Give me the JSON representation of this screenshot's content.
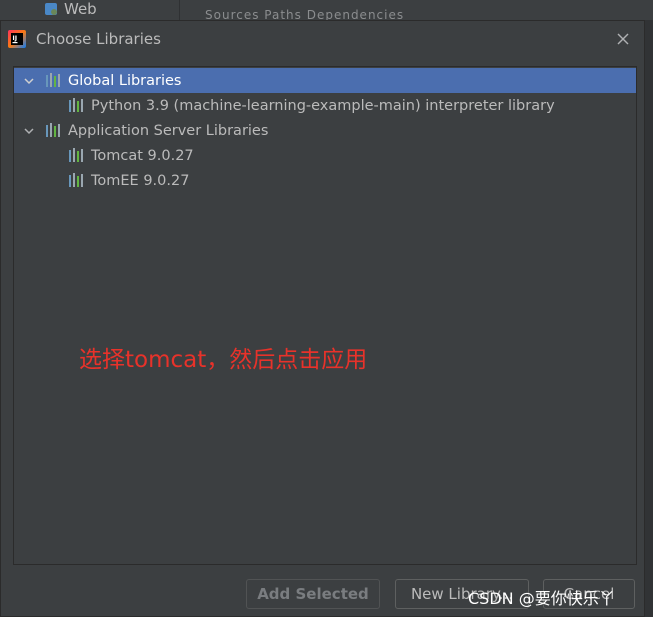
{
  "background": {
    "sidebar_item": "Web",
    "tabs_text": "Sources   Paths   Dependencies"
  },
  "dialog": {
    "title": "Choose Libraries",
    "close_icon": "close-icon"
  },
  "tree": {
    "items": [
      {
        "label": "Global Libraries",
        "level": 0,
        "expanded": true,
        "selected": true
      },
      {
        "label": "Python 3.9 (machine-learning-example-main) interpreter library",
        "level": 1
      },
      {
        "label": "Application Server Libraries",
        "level": 0,
        "expanded": true,
        "selected": false
      },
      {
        "label": "Tomcat 9.0.27",
        "level": 1
      },
      {
        "label": "TomEE 9.0.27",
        "level": 1
      }
    ]
  },
  "annotation": "选择tomcat，然后点击应用",
  "buttons": {
    "add_selected": "Add Selected",
    "new_library": "New Library...",
    "cancel": "Cancel"
  },
  "watermark": "CSDN @要你快乐丫",
  "colors": {
    "selection": "#4b6eaf",
    "annotation": "#e8322a",
    "background": "#3c3f41"
  }
}
